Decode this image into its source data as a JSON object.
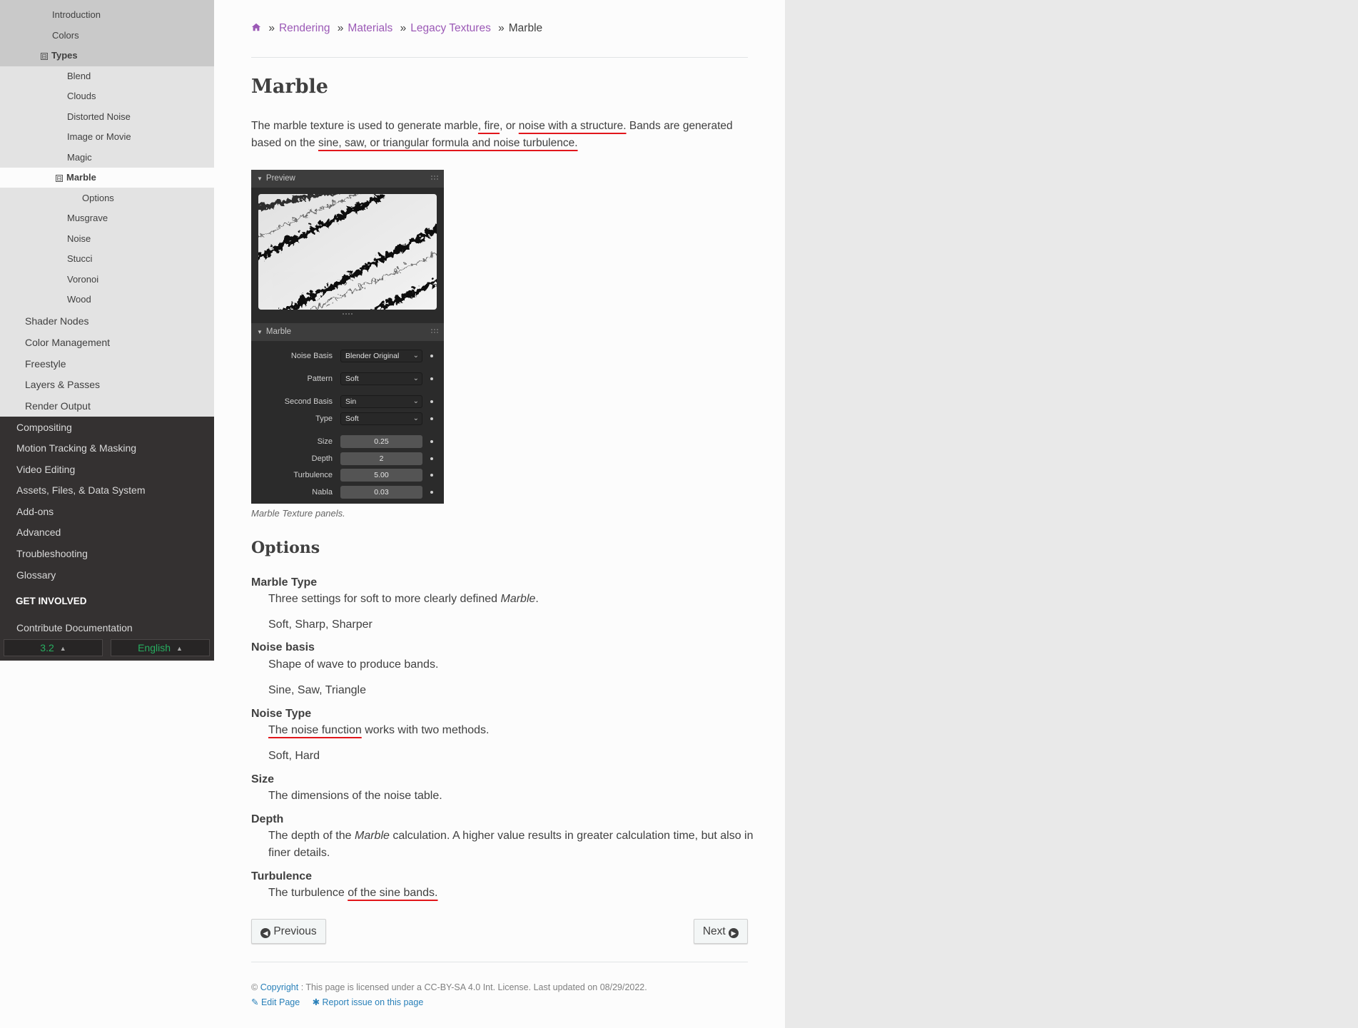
{
  "sidebar": {
    "texture_items": [
      "Introduction",
      "Colors"
    ],
    "types_label": "Types",
    "expand_glyph": "⊟",
    "type_items": [
      "Blend",
      "Clouds",
      "Distorted Noise",
      "Image or Movie",
      "Magic"
    ],
    "current": "Marble",
    "current_sub": "Options",
    "type_items_after": [
      "Musgrave",
      "Noise",
      "Stucci",
      "Voronoi",
      "Wood"
    ],
    "rendering_items": [
      "Shader Nodes",
      "Color Management",
      "Freestyle",
      "Layers & Passes",
      "Render Output"
    ],
    "top_items": [
      "Compositing",
      "Motion Tracking & Masking",
      "Video Editing",
      "Assets, Files, & Data System",
      "Add-ons",
      "Advanced",
      "Troubleshooting",
      "Glossary"
    ],
    "caption": "GET INVOLVED",
    "contribute": "Contribute Documentation",
    "version": "3.2",
    "language": "English"
  },
  "breadcrumb": {
    "items": [
      "Rendering",
      "Materials",
      "Legacy Textures"
    ],
    "current": "Marble",
    "sep": "»"
  },
  "page": {
    "title": "Marble",
    "intro_parts": [
      "The marble texture is used to generate marble",
      ", fire",
      ", or ",
      "noise with a structure.",
      " Bands are generated"
    ],
    "intro_line2_parts": [
      "based on the ",
      "sine, saw, or triangular formula and noise turbulence."
    ],
    "figure_caption": "Marble Texture panels.",
    "options_heading": "Options"
  },
  "panel": {
    "preview_label": "Preview",
    "marble_label": "Marble",
    "noise_basis_label": "Noise Basis",
    "noise_basis_value": "Blender Original",
    "pattern_label": "Pattern",
    "pattern_value": "Soft",
    "second_basis_label": "Second Basis",
    "second_basis_value": "Sin",
    "type_label": "Type",
    "type_value": "Soft",
    "size_label": "Size",
    "size_value": "0.25",
    "depth_label": "Depth",
    "depth_value": "2",
    "turbulence_label": "Turbulence",
    "turbulence_value": "5.00",
    "nabla_label": "Nabla",
    "nabla_value": "0.03"
  },
  "options": {
    "marble_type": {
      "term": "Marble Type",
      "desc_pre": "Three settings for soft to more clearly defined ",
      "desc_em": "Marble",
      "desc_post": ".",
      "values": "Soft, Sharp, Sharper"
    },
    "noise_basis": {
      "term": "Noise basis",
      "desc": "Shape of wave to produce bands.",
      "values": "Sine, Saw, Triangle"
    },
    "noise_type": {
      "term": "Noise Type",
      "desc_ul": "The noise function",
      "desc_post": " works with two methods.",
      "values": "Soft, Hard"
    },
    "size": {
      "term": "Size",
      "desc": "The dimensions of the noise table."
    },
    "depth": {
      "term": "Depth",
      "desc_pre": "The depth of the ",
      "desc_em": "Marble",
      "desc_post": " calculation. A higher value results in greater calculation time, but also in",
      "desc_line2": "finer details."
    },
    "turbulence": {
      "term": "Turbulence",
      "desc_pre": "The turbulence ",
      "desc_ul": "of the sine bands."
    }
  },
  "nav_buttons": {
    "previous": "Previous",
    "next": "Next"
  },
  "footer": {
    "copyright_symbol": "©",
    "copyright_link": "Copyright",
    "license_text": ": This page is licensed under a CC-BY-SA 4.0 Int. License. Last updated on 08/29/2022.",
    "edit_page": "Edit Page",
    "report_issue": "Report issue on this page"
  },
  "colors": {
    "link_purple": "#9b59b6",
    "link_blue": "#2980b9",
    "version_green": "#27ae60",
    "annotation_red": "#e2161b"
  }
}
